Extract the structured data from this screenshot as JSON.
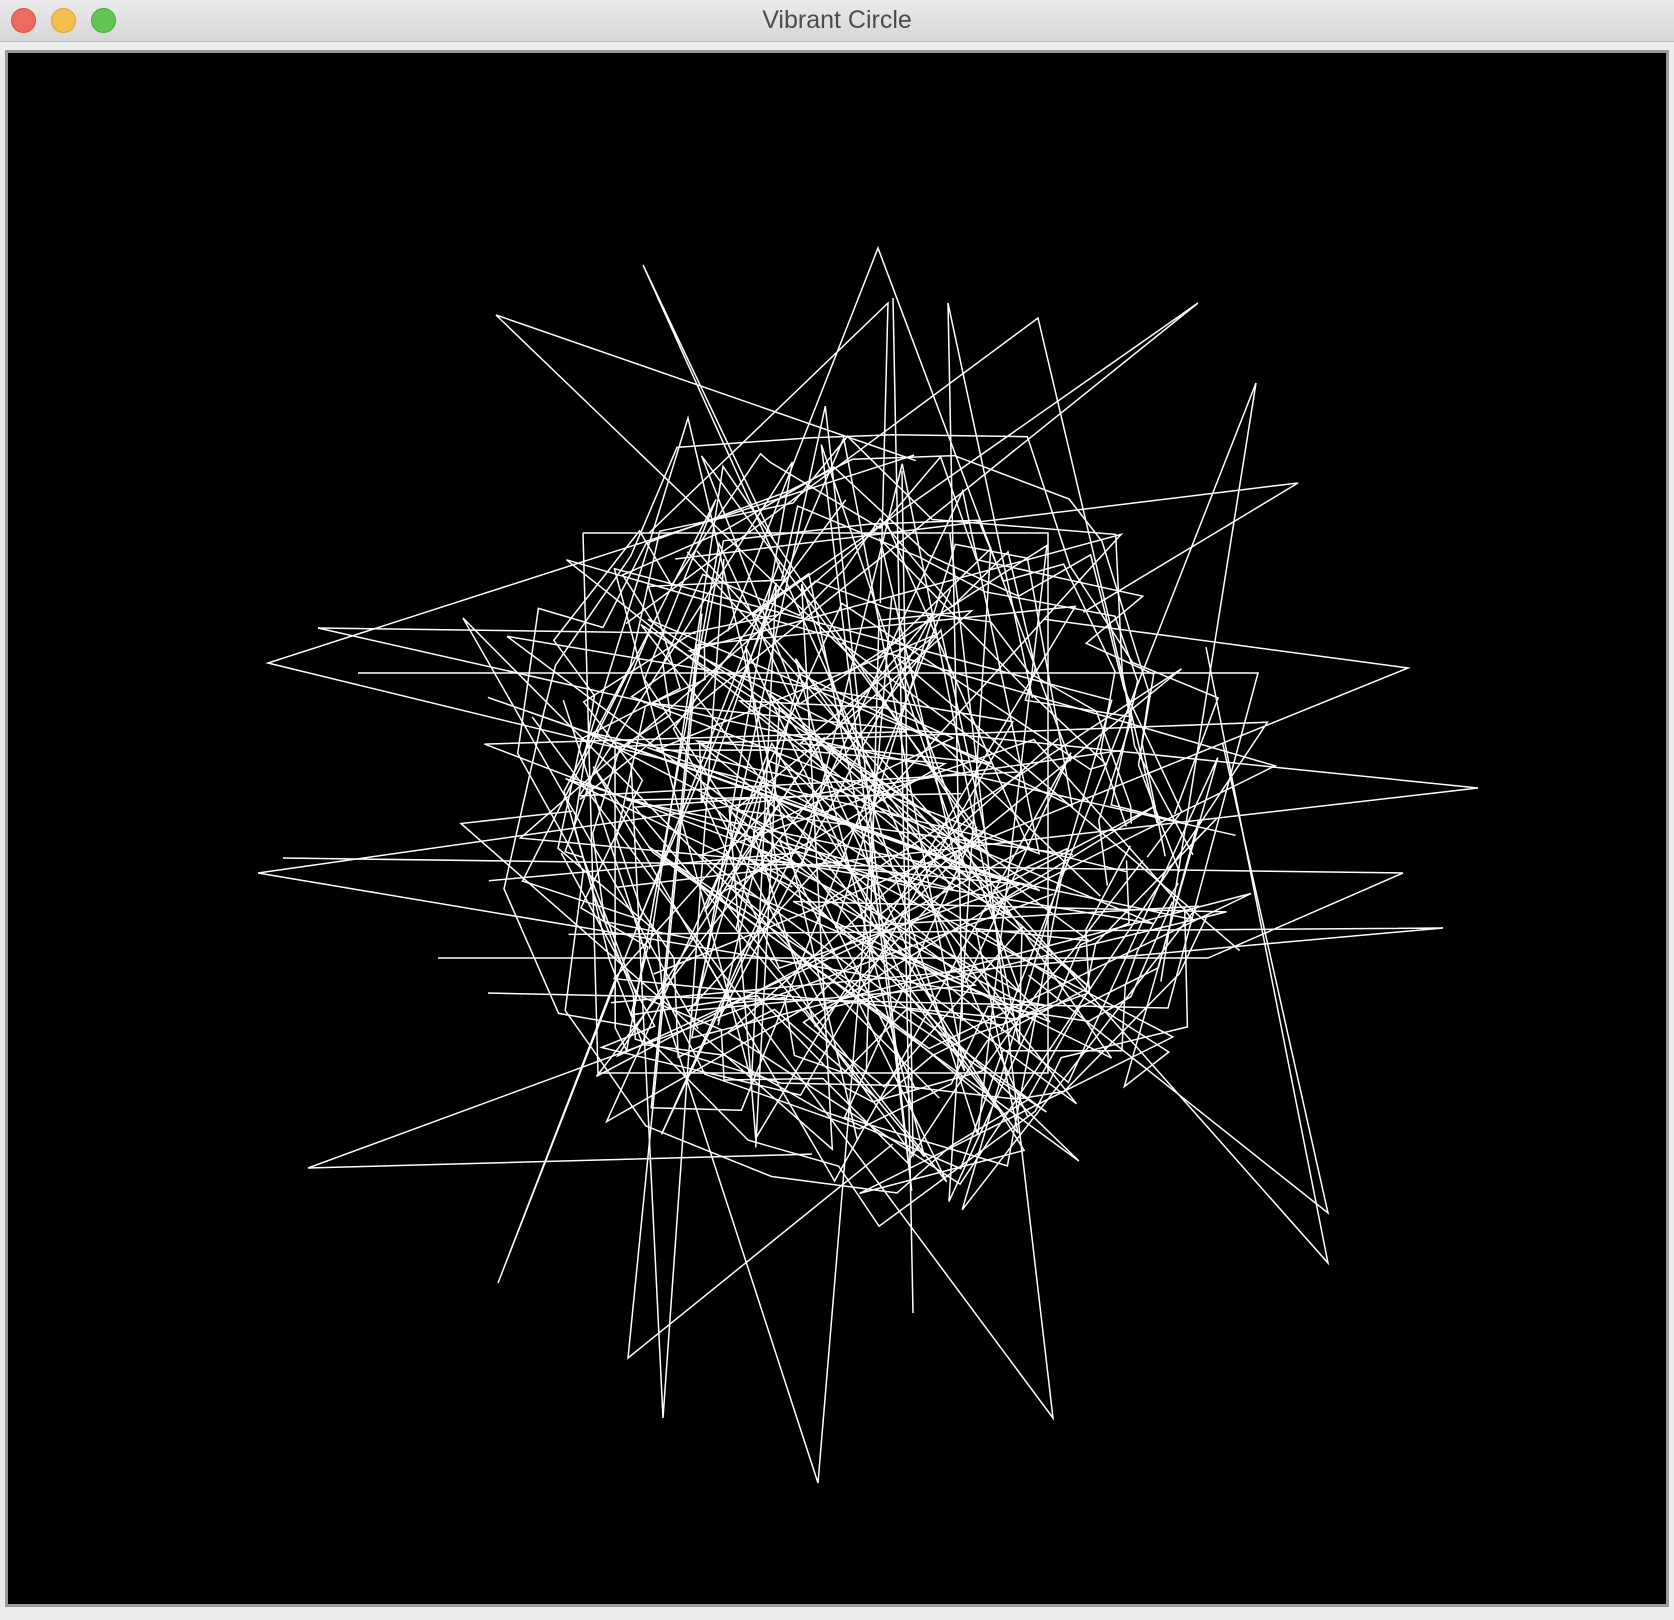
{
  "window": {
    "title": "Vibrant Circle"
  },
  "traffic_lights": [
    {
      "name": "close",
      "color": "#ed6a5e"
    },
    {
      "name": "minimize",
      "color": "#f5bf4f"
    },
    {
      "name": "zoom",
      "color": "#61c554"
    }
  ],
  "canvas": {
    "background": "#000000",
    "stroke": "#ffffff",
    "shape": "jagged-star-circle"
  }
}
